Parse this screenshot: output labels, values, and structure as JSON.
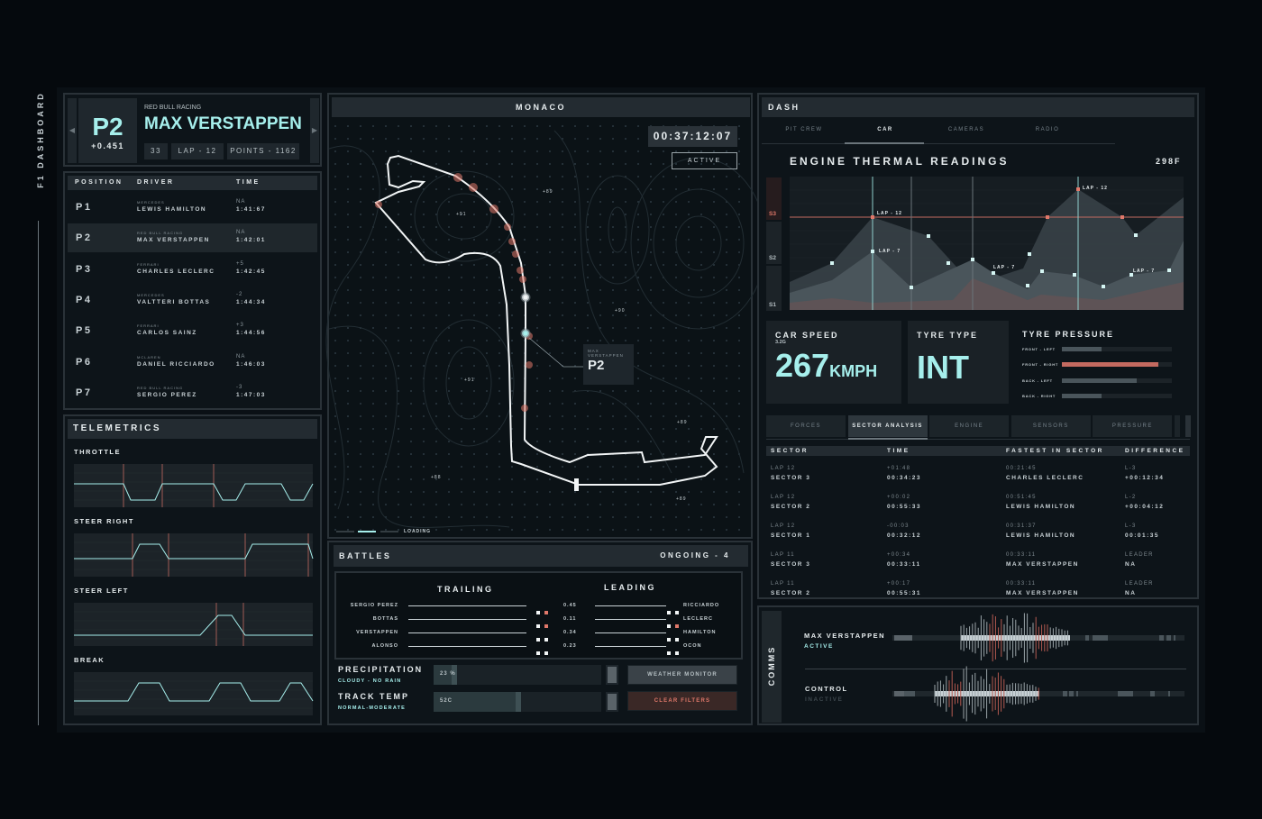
{
  "app": {
    "title": "F1 DASHBOARD"
  },
  "driver_card": {
    "position": "P2",
    "gap": "+0.451",
    "team": "RED BULL RACING",
    "name": "MAX VERSTAPPEN",
    "number": "33",
    "lap": "LAP - 12",
    "points": "POINTS - 1162"
  },
  "standings": {
    "headers": [
      "POSITION",
      "DRIVER",
      "TIME"
    ],
    "rows": [
      {
        "pos": "P1",
        "team": "MERCEDES",
        "driver": "LEWIS HAMILTON",
        "delta": "NA",
        "time": "1:41:67"
      },
      {
        "pos": "P2",
        "team": "RED BULL RACING",
        "driver": "MAX VERSTAPPEN",
        "delta": "NA",
        "time": "1:42:01"
      },
      {
        "pos": "P3",
        "team": "FERRARI",
        "driver": "CHARLES LECLERC",
        "delta": "+5",
        "time": "1:42:45"
      },
      {
        "pos": "P4",
        "team": "MERCEDES",
        "driver": "VALTTERI BOTTAS",
        "delta": "-2",
        "time": "1:44:34"
      },
      {
        "pos": "P5",
        "team": "FERRARI",
        "driver": "CARLOS SAINZ",
        "delta": "+3",
        "time": "1:44:56"
      },
      {
        "pos": "P6",
        "team": "MCLAREN",
        "driver": "DANIEL RICCIARDO",
        "delta": "NA",
        "time": "1:46:03"
      },
      {
        "pos": "P7",
        "team": "RED BULL RACING",
        "driver": "SERGIO PEREZ",
        "delta": "-3",
        "time": "1:47:03"
      }
    ]
  },
  "telemetrics": {
    "title": "TELEMETRICS",
    "channels": [
      "THROTTLE",
      "STEER RIGHT",
      "STEER LEFT",
      "BREAK"
    ]
  },
  "map": {
    "title": "MONACO",
    "timer": "00:37:12:07",
    "status": "ACTIVE",
    "loading": "LOADING",
    "marker_name_1": "MAX",
    "marker_name_2": "VERSTAPPEN",
    "marker_pos": "P2",
    "elevations": [
      "+89",
      "+91",
      "+90",
      "+91",
      "+89",
      "+88",
      "+89"
    ]
  },
  "battles": {
    "title": "BATTLES",
    "ongoing": "ONGOING - 4",
    "trailing_label": "TRAILING",
    "leading_label": "LEADING",
    "rows": [
      {
        "trailing": "SERGIO PEREZ",
        "gap": "0.45",
        "leading": "RICCIARDO",
        "alert_trailing": true,
        "alert_leading": false
      },
      {
        "trailing": "BOTTAS",
        "gap": "0.11",
        "leading": "LECLERC",
        "alert_trailing": true,
        "alert_leading": true
      },
      {
        "trailing": "VERSTAPPEN",
        "gap": "0.34",
        "leading": "HAMILTON",
        "alert_trailing": false,
        "alert_leading": false
      },
      {
        "trailing": "ALONSO",
        "gap": "0.23",
        "leading": "OCON",
        "alert_trailing": false,
        "alert_leading": false
      }
    ]
  },
  "weather": {
    "precip_label": "PRECIPITATION",
    "precip_sub": "CLOUDY - NO RAIN",
    "precip_value": "23 %",
    "precip_fraction": 0.23,
    "temp_label": "TRACK TEMP",
    "temp_sub": "NORMAL-MODERATE",
    "temp_value": "52C",
    "temp_fraction": 0.52,
    "weather_button": "WEATHER MONITOR",
    "clear_button": "CLEAR FILTERS"
  },
  "dash": {
    "title": "DASH",
    "tabs": [
      "PIT CREW",
      "CAR",
      "CAMERAS",
      "RADIO"
    ],
    "active_tab": "CAR",
    "thermal_title": "ENGINE THERMAL READINGS",
    "thermal_value": "298F",
    "sectors": [
      "S3",
      "S2",
      "S1"
    ],
    "annotations": [
      "LAP - 12",
      "LAP - 7",
      "LAP - 12",
      "LAP - 7",
      "LAP - 7"
    ],
    "speed_label": "CAR SPEED",
    "speed_sub": "3.2G",
    "speed_value": "267",
    "speed_unit": "KMPH",
    "tyre_label": "TYRE TYPE",
    "tyre_value": "INT",
    "pressure_label": "TYRE PRESSURE",
    "pressure": [
      {
        "label": "FRONT - LEFT",
        "fraction": 0.36
      },
      {
        "label": "FRONT - RIGHT",
        "fraction": 0.88,
        "alert": true
      },
      {
        "label": "BACK - LEFT",
        "fraction": 0.68
      },
      {
        "label": "BACK - RIGHT",
        "fraction": 0.36
      }
    ],
    "sub_tabs": [
      "FORCES",
      "SECTOR ANALYSIS",
      "ENGINE",
      "SENSORS",
      "PRESSURE"
    ],
    "active_sub_tab": "SECTOR ANALYSIS",
    "sector_headers": [
      "SECTOR",
      "TIME",
      "FASTEST IN SECTOR",
      "DIFFERENCE"
    ],
    "sector_rows": [
      {
        "lap": "LAP 12",
        "sector": "SECTOR 3",
        "delta": "+01:48",
        "time": "00:34:23",
        "fast_time": "00:21:45",
        "fast_driver": "CHARLES LECLERC",
        "diff_top": "L-3",
        "diff": "+00:12:34"
      },
      {
        "lap": "LAP 12",
        "sector": "SECTOR 2",
        "delta": "+00:02",
        "time": "00:55:33",
        "fast_time": "00:51:45",
        "fast_driver": "LEWIS HAMILTON",
        "diff_top": "L-2",
        "diff": "+00:04:12"
      },
      {
        "lap": "LAP 12",
        "sector": "SECTOR 1",
        "delta": "-00:03",
        "time": "00:32:12",
        "fast_time": "00:31:37",
        "fast_driver": "LEWIS HAMILTON",
        "diff_top": "L-3",
        "diff": "00:01:35"
      },
      {
        "lap": "LAP 11",
        "sector": "SECTOR 3",
        "delta": "+00:34",
        "time": "00:33:11",
        "fast_time": "00:33:11",
        "fast_driver": "MAX VERSTAPPEN",
        "diff_top": "LEADER",
        "diff": "NA"
      },
      {
        "lap": "LAP 11",
        "sector": "SECTOR 2",
        "delta": "+00:17",
        "time": "00:55:31",
        "fast_time": "00:33:11",
        "fast_driver": "MAX VERSTAPPEN",
        "diff_top": "LEADER",
        "diff": "NA"
      }
    ]
  },
  "comms": {
    "title": "COMMS",
    "channels": [
      {
        "name": "MAX VERSTAPPEN",
        "status": "ACTIVE"
      },
      {
        "name": "CONTROL",
        "status": "INACTIVE"
      }
    ]
  },
  "colors": {
    "accent": "#a6efec",
    "alert": "#e0786a",
    "panel": "#0d1419",
    "bar": "#232b31"
  }
}
